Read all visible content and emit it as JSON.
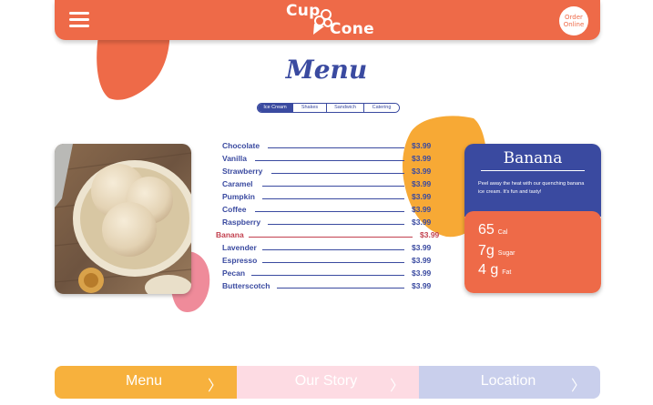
{
  "header": {
    "logo_top": "Cup",
    "logo_bottom": "Cone",
    "order_label": "Order Online"
  },
  "title": "Menu",
  "tabs": [
    "Ice Cream",
    "Shakes",
    "Sandwich",
    "Catering"
  ],
  "menu": {
    "items": [
      {
        "name": "Chocolate",
        "price": "$3.99"
      },
      {
        "name": "Vanilla",
        "price": "$3.99"
      },
      {
        "name": "Strawberry",
        "price": "$3.99"
      },
      {
        "name": "Caramel",
        "price": "$3.99"
      },
      {
        "name": "Pumpkin",
        "price": "$3.99"
      },
      {
        "name": "Coffee",
        "price": "$3.99"
      },
      {
        "name": "Raspberry",
        "price": "$3.99"
      },
      {
        "name": "Banana",
        "price": "$3.99"
      },
      {
        "name": "Lavender",
        "price": "$3.99"
      },
      {
        "name": "Espresso",
        "price": "$3.99"
      },
      {
        "name": "Pecan",
        "price": "$3.99"
      },
      {
        "name": "Butterscotch",
        "price": "$3.99"
      }
    ],
    "selected": "Banana"
  },
  "card": {
    "title": "Banana",
    "description": "Peel away the heat with our quenching banana ice cream. It's fun and tasty!",
    "stats": [
      {
        "value": "65",
        "unit": "Cal"
      },
      {
        "value": "7g",
        "unit": "Sugar"
      },
      {
        "value": "4 g",
        "unit": "Fat"
      }
    ]
  },
  "bottom_nav": [
    {
      "label": "Menu",
      "chevron": "〉"
    },
    {
      "label": "Our Story",
      "chevron": "〉"
    },
    {
      "label": "Location",
      "chevron": "〉"
    }
  ],
  "colors": {
    "primary": "#ee6a48",
    "secondary": "#3a4aa0",
    "accent": "#f7a935",
    "highlight": "#c2414f",
    "nav_menu": "#f7b13d",
    "nav_story": "#fddbe3",
    "nav_location": "#c9cfec"
  }
}
